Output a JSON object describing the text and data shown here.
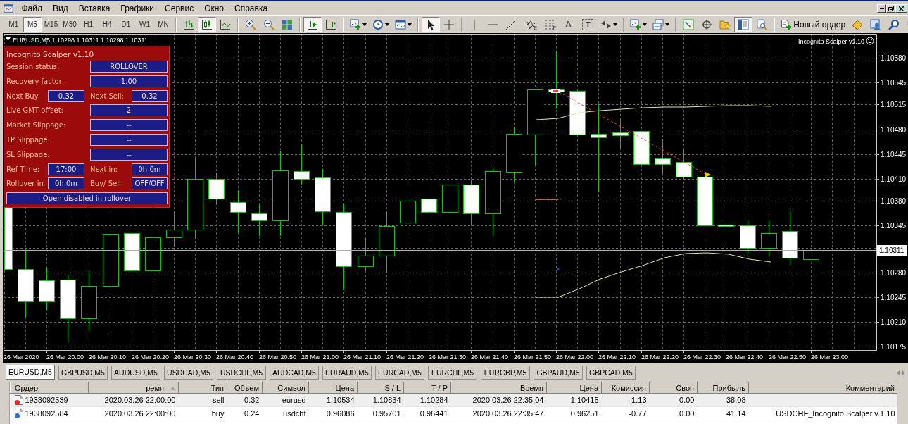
{
  "window": {
    "menu": [
      "Файл",
      "Вид",
      "Вставка",
      "Графики",
      "Сервис",
      "Окно",
      "Справка"
    ]
  },
  "toolbar": {
    "timeframes": [
      {
        "label": "M1",
        "selected": false
      },
      {
        "label": "M5",
        "selected": true
      },
      {
        "label": "M15",
        "selected": false
      },
      {
        "label": "M30",
        "selected": false
      },
      {
        "label": "H1",
        "selected": false
      },
      {
        "label": "H4",
        "selected": false
      },
      {
        "label": "D1",
        "selected": false
      },
      {
        "label": "W1",
        "selected": false
      },
      {
        "label": "MN",
        "selected": false
      }
    ],
    "chart_types": [
      {
        "selected": false
      },
      {
        "selected": true
      },
      {
        "selected": false
      }
    ],
    "chart_toggles": [
      {
        "on": true
      },
      {
        "on": false
      }
    ],
    "pointer_modes": [
      {
        "selected": true
      },
      {
        "selected": false
      }
    ],
    "channel_mark": "E",
    "fibo_mark": "F",
    "text_tool": "A",
    "label_tool": "T",
    "window_toggles": [
      {
        "on": false
      },
      {
        "on": false
      },
      {
        "on": false
      },
      {
        "on": true
      },
      {
        "on": false
      }
    ],
    "new_order": "Новый ордер"
  },
  "chart": {
    "header": "EURUSD,M5 1.10298 1.10311 1.10298 1.10311",
    "expert": "Incognito Scalper v1.10",
    "price_axis": [
      "1.10580",
      "1.10545",
      "1.10515",
      "1.10480",
      "1.10445",
      "1.10410",
      "1.10380",
      "1.10345",
      "1.10280",
      "1.10245",
      "1.10210",
      "1.10175"
    ],
    "current_price": "1.10311",
    "time_axis": [
      "26 Mar 2020",
      "26 Mar 20:00",
      "26 Mar 20:10",
      "26 Mar 20:20",
      "26 Mar 20:30",
      "26 Mar 20:40",
      "26 Mar 20:50",
      "26 Mar 21:00",
      "26 Mar 21:10",
      "26 Mar 21:20",
      "26 Mar 21:30",
      "26 Mar 21:40",
      "26 Mar 21:50",
      "26 Mar 22:00",
      "26 Mar 22:10",
      "26 Mar 22:20",
      "26 Mar 22:30",
      "26 Mar 22:40",
      "26 Mar 22:50",
      "26 Mar 23:00"
    ]
  },
  "panel": {
    "title": "Incognito Scalper v1.10",
    "rows": [
      {
        "kind": "field",
        "label": "Session status:",
        "value": "ROLLOVER"
      },
      {
        "kind": "field",
        "label": "Recovery factor:",
        "value": "1.00"
      },
      {
        "kind": "pair",
        "items": [
          {
            "label": "Next Buy:",
            "value": "0.32"
          },
          {
            "label": "Next Sell:",
            "value": "0.32"
          }
        ]
      },
      {
        "kind": "field",
        "label": "Live GMT offset:",
        "value": "2"
      },
      {
        "kind": "field",
        "label": "Market Slippage:",
        "value": "--"
      },
      {
        "kind": "field",
        "label": "TP Slippage:",
        "value": "--"
      },
      {
        "kind": "field",
        "label": "SL Slippage:",
        "value": "--"
      },
      {
        "kind": "pair",
        "items": [
          {
            "label": "Ref Time:",
            "value": "17:00"
          },
          {
            "label": "Next in:",
            "value": "0h 0m"
          }
        ]
      },
      {
        "kind": "pair",
        "items": [
          {
            "label": "Rollover in",
            "value": "0h 0m"
          },
          {
            "label": "Buy/ Sell:",
            "value": "OFF/OFF"
          }
        ]
      },
      {
        "kind": "banner",
        "value": "Open disabled in rollover"
      }
    ]
  },
  "chart_tabs": [
    {
      "label": "EURUSD,M5",
      "selected": true
    },
    {
      "label": "GBPUSD,M5",
      "selected": false
    },
    {
      "label": "AUDUSD,M5",
      "selected": false
    },
    {
      "label": "USDCAD,M5",
      "selected": false
    },
    {
      "label": "USDCHF,M5",
      "selected": false
    },
    {
      "label": "AUDCAD,M5",
      "selected": false
    },
    {
      "label": "EURAUD,M5",
      "selected": false
    },
    {
      "label": "EURCAD,M5",
      "selected": false
    },
    {
      "label": "EURCHF,M5",
      "selected": false
    },
    {
      "label": "EURGBP,M5",
      "selected": false
    },
    {
      "label": "GBPAUD,M5",
      "selected": false
    },
    {
      "label": "GBPCAD,M5",
      "selected": false
    }
  ],
  "trade_table": {
    "columns": [
      {
        "label": "Ордер",
        "sorted": false
      },
      {
        "label": "ремя",
        "sorted": true
      },
      {
        "label": "Тип",
        "sorted": false
      },
      {
        "label": "Объем",
        "sorted": false
      },
      {
        "label": "Символ",
        "sorted": false
      },
      {
        "label": "Цена",
        "sorted": false
      },
      {
        "label": "S / L",
        "sorted": false
      },
      {
        "label": "T / P",
        "sorted": false
      },
      {
        "label": "Время",
        "sorted": false
      },
      {
        "label": "Цена",
        "sorted": false
      },
      {
        "label": "Комиссия",
        "sorted": false
      },
      {
        "label": "Своп",
        "sorted": false
      },
      {
        "label": "Прибыль",
        "sorted": false
      },
      {
        "label": "Комментарий",
        "sorted": false
      }
    ],
    "rows": [
      {
        "color": "#e02828",
        "cells": [
          "1938092539",
          "2020.03.26 22:00:00",
          "sell",
          "0.32",
          "eurusd",
          "1.10534",
          "1.10834",
          "1.10284",
          "2020.03.26 22:35:04",
          "1.10415",
          "-1.13",
          "0.00",
          "38.08"
        ]
      },
      {
        "color": "#2f6fd0",
        "cells": [
          "1938092584",
          "2020.03.26 22:00:00",
          "buy",
          "0.24",
          "usdchf",
          "0.96086",
          "0.95701",
          "0.96441",
          "2020.03.26 22:35:47",
          "0.96251",
          "-0.77",
          "0.00",
          "41.14",
          "USDCHF_Incognito Scalper v.1.10"
        ]
      }
    ]
  }
}
